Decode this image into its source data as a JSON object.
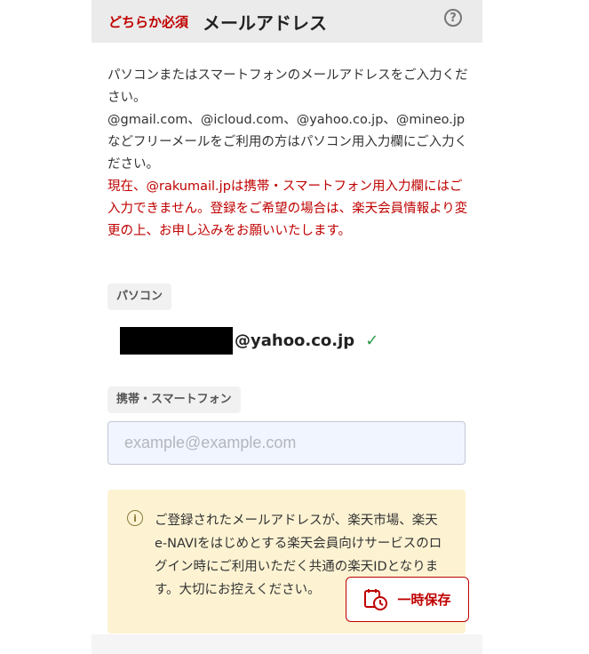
{
  "header": {
    "required_label": "どちらか必須",
    "title": "メールアドレス",
    "help_icon": "question-circle-icon"
  },
  "description": {
    "line1": "パソコンまたはスマートフォンのメールアドレスをご入力ください。",
    "line2": "@gmail.com、@icloud.com、@yahoo.co.jp、@mineo.jpなどフリーメールをご利用の方はパソコン用入力欄にご入力ください。",
    "warning": "現在、@rakumail.jpは携帯・スマートフォン用入力欄にはご入力できません。登録をご希望の場合は、楽天会員情報より変更の上、お申し込みをお願いいたします。"
  },
  "pc": {
    "label": "パソコン",
    "email_domain": "@yahoo.co.jp",
    "verified_icon": "checkmark-icon"
  },
  "mobile": {
    "label": "携帯・スマートフォン",
    "placeholder": "example@example.com",
    "value": ""
  },
  "notice": {
    "icon": "info-circle-icon",
    "text": "ご登録されたメールアドレスが、楽天市場、楽天e-NAVIをはじめとする楽天会員向けサービスのログイン時にご利用いただく共通の楽天IDとなります。大切にお控えください。"
  },
  "save_button": {
    "label": "一時保存",
    "icon": "save-clock-icon"
  },
  "colors": {
    "accent": "#bf0000",
    "header_bg": "#ebebeb",
    "notice_bg": "#fdf3d3",
    "input_bg": "#f1f5ff",
    "success": "#2e9a48"
  }
}
